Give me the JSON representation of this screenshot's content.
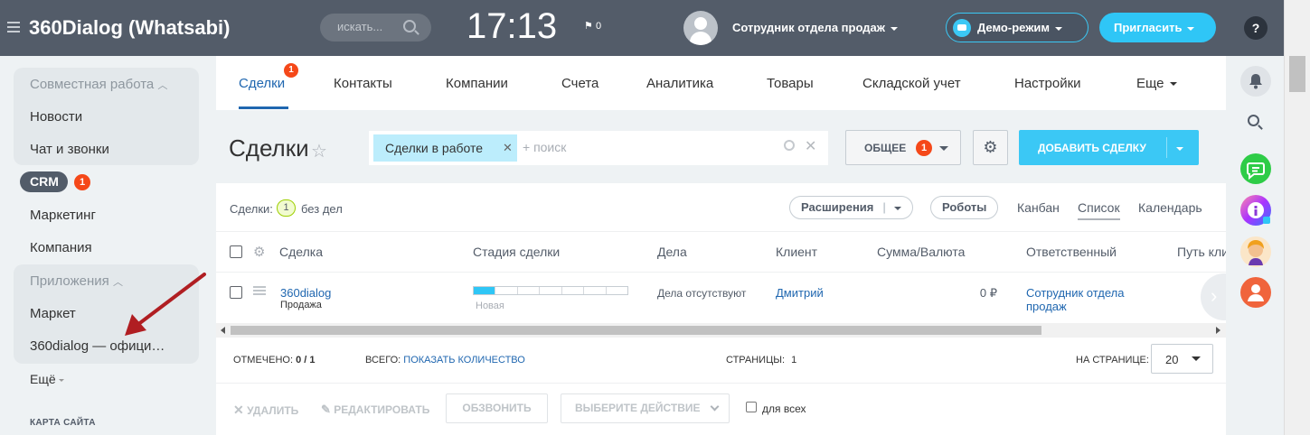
{
  "header": {
    "app_title": "360Dialog (Whatsabi)",
    "search_placeholder": "искать...",
    "clock": "17:13",
    "flag_count": "0",
    "user_name": "Сотрудник отдела продаж",
    "demo_label": "Демо-режим",
    "invite_label": "Пригласить",
    "help_label": "?"
  },
  "sidebar": {
    "group1_title": "Совместная работа",
    "news": "Новости",
    "chat": "Чат и звонки",
    "crm": "CRM",
    "crm_badge": "1",
    "marketing": "Маркетинг",
    "company": "Компания",
    "group2_title": "Приложения",
    "market": "Маркет",
    "app_360": "360dialog — офици…",
    "more": "Ещё",
    "sitemap": "КАРТА САЙТА"
  },
  "tabs": {
    "deals": "Сделки",
    "deals_badge": "1",
    "contacts": "Контакты",
    "companies": "Компании",
    "invoices": "Счета",
    "analytics": "Аналитика",
    "products": "Товары",
    "warehouse": "Складской учет",
    "settings": "Настройки",
    "more": "Еще"
  },
  "toolbar": {
    "title": "Сделки",
    "filter_chip": "Сделки в работе",
    "filter_placeholder": "+ поиск",
    "common_label": "ОБЩЕЕ",
    "common_badge": "1",
    "add_deal": "ДОБАВИТЬ СДЕЛКУ"
  },
  "subbar": {
    "deals_label": "Сделки:",
    "deals_count": "1",
    "no_deals": "без дел",
    "extensions": "Расширения",
    "robots": "Роботы",
    "kanban": "Канбан",
    "list": "Список",
    "calendar": "Календарь"
  },
  "table": {
    "columns": [
      "Сделка",
      "Стадия сделки",
      "Дела",
      "Клиент",
      "Сумма/Валюта",
      "Ответственный",
      "Путь кли"
    ],
    "row": {
      "name": "360dialog",
      "type": "Продажа",
      "stage": "Новая",
      "activities": "Дела отсутствуют",
      "client": "Дмитрий",
      "amount": "0 ₽",
      "responsible_line1": "Сотрудник отдела",
      "responsible_line2": "продаж"
    }
  },
  "footer": {
    "marked_label": "ОТМЕЧЕНО:",
    "marked_value": "0 / 1",
    "total_label": "ВСЕГО:",
    "total_link": "ПОКАЗАТЬ КОЛИЧЕСТВО",
    "pages_label": "СТРАНИЦЫ:",
    "pages_value": "1",
    "per_page_label": "НА СТРАНИЦЕ:",
    "per_page_value": "20"
  },
  "actions": {
    "delete": "УДАЛИТЬ",
    "edit": "РЕДАКТИРОВАТЬ",
    "call": "ОБЗВОНИТЬ",
    "select_action": "ВЫБЕРИТЕ ДЕЙСТВИЕ",
    "for_all": "для всех"
  },
  "stage_progress": 0.14,
  "colors": {
    "topbar": "#535c69",
    "accent": "#2fc6f6",
    "link": "#2067b0",
    "badge": "#f54819",
    "arrow": "#b01e22"
  }
}
